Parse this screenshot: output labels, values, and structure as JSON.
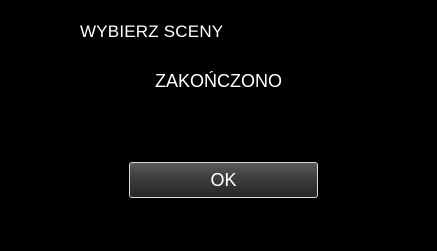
{
  "screen": {
    "title": "WYBIERZ SCENY",
    "message": "ZAKOŃCZONO"
  },
  "dialog": {
    "ok_label": "OK"
  },
  "colors": {
    "background": "#000000",
    "text": "#ffffff",
    "button_border": "#d9d9d9"
  }
}
